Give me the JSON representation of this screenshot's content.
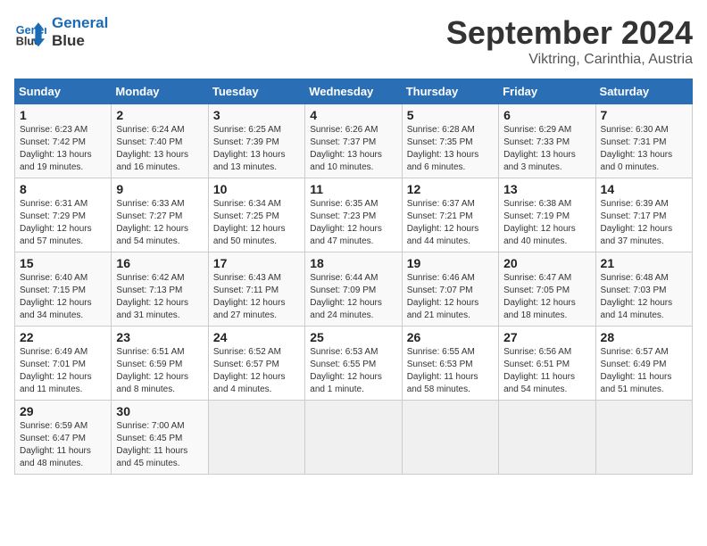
{
  "header": {
    "logo_line1": "General",
    "logo_line2": "Blue",
    "month": "September 2024",
    "location": "Viktring, Carinthia, Austria"
  },
  "weekdays": [
    "Sunday",
    "Monday",
    "Tuesday",
    "Wednesday",
    "Thursday",
    "Friday",
    "Saturday"
  ],
  "weeks": [
    [
      {
        "day": "1",
        "lines": [
          "Sunrise: 6:23 AM",
          "Sunset: 7:42 PM",
          "Daylight: 13 hours",
          "and 19 minutes."
        ]
      },
      {
        "day": "2",
        "lines": [
          "Sunrise: 6:24 AM",
          "Sunset: 7:40 PM",
          "Daylight: 13 hours",
          "and 16 minutes."
        ]
      },
      {
        "day": "3",
        "lines": [
          "Sunrise: 6:25 AM",
          "Sunset: 7:39 PM",
          "Daylight: 13 hours",
          "and 13 minutes."
        ]
      },
      {
        "day": "4",
        "lines": [
          "Sunrise: 6:26 AM",
          "Sunset: 7:37 PM",
          "Daylight: 13 hours",
          "and 10 minutes."
        ]
      },
      {
        "day": "5",
        "lines": [
          "Sunrise: 6:28 AM",
          "Sunset: 7:35 PM",
          "Daylight: 13 hours",
          "and 6 minutes."
        ]
      },
      {
        "day": "6",
        "lines": [
          "Sunrise: 6:29 AM",
          "Sunset: 7:33 PM",
          "Daylight: 13 hours",
          "and 3 minutes."
        ]
      },
      {
        "day": "7",
        "lines": [
          "Sunrise: 6:30 AM",
          "Sunset: 7:31 PM",
          "Daylight: 13 hours",
          "and 0 minutes."
        ]
      }
    ],
    [
      {
        "day": "8",
        "lines": [
          "Sunrise: 6:31 AM",
          "Sunset: 7:29 PM",
          "Daylight: 12 hours",
          "and 57 minutes."
        ]
      },
      {
        "day": "9",
        "lines": [
          "Sunrise: 6:33 AM",
          "Sunset: 7:27 PM",
          "Daylight: 12 hours",
          "and 54 minutes."
        ]
      },
      {
        "day": "10",
        "lines": [
          "Sunrise: 6:34 AM",
          "Sunset: 7:25 PM",
          "Daylight: 12 hours",
          "and 50 minutes."
        ]
      },
      {
        "day": "11",
        "lines": [
          "Sunrise: 6:35 AM",
          "Sunset: 7:23 PM",
          "Daylight: 12 hours",
          "and 47 minutes."
        ]
      },
      {
        "day": "12",
        "lines": [
          "Sunrise: 6:37 AM",
          "Sunset: 7:21 PM",
          "Daylight: 12 hours",
          "and 44 minutes."
        ]
      },
      {
        "day": "13",
        "lines": [
          "Sunrise: 6:38 AM",
          "Sunset: 7:19 PM",
          "Daylight: 12 hours",
          "and 40 minutes."
        ]
      },
      {
        "day": "14",
        "lines": [
          "Sunrise: 6:39 AM",
          "Sunset: 7:17 PM",
          "Daylight: 12 hours",
          "and 37 minutes."
        ]
      }
    ],
    [
      {
        "day": "15",
        "lines": [
          "Sunrise: 6:40 AM",
          "Sunset: 7:15 PM",
          "Daylight: 12 hours",
          "and 34 minutes."
        ]
      },
      {
        "day": "16",
        "lines": [
          "Sunrise: 6:42 AM",
          "Sunset: 7:13 PM",
          "Daylight: 12 hours",
          "and 31 minutes."
        ]
      },
      {
        "day": "17",
        "lines": [
          "Sunrise: 6:43 AM",
          "Sunset: 7:11 PM",
          "Daylight: 12 hours",
          "and 27 minutes."
        ]
      },
      {
        "day": "18",
        "lines": [
          "Sunrise: 6:44 AM",
          "Sunset: 7:09 PM",
          "Daylight: 12 hours",
          "and 24 minutes."
        ]
      },
      {
        "day": "19",
        "lines": [
          "Sunrise: 6:46 AM",
          "Sunset: 7:07 PM",
          "Daylight: 12 hours",
          "and 21 minutes."
        ]
      },
      {
        "day": "20",
        "lines": [
          "Sunrise: 6:47 AM",
          "Sunset: 7:05 PM",
          "Daylight: 12 hours",
          "and 18 minutes."
        ]
      },
      {
        "day": "21",
        "lines": [
          "Sunrise: 6:48 AM",
          "Sunset: 7:03 PM",
          "Daylight: 12 hours",
          "and 14 minutes."
        ]
      }
    ],
    [
      {
        "day": "22",
        "lines": [
          "Sunrise: 6:49 AM",
          "Sunset: 7:01 PM",
          "Daylight: 12 hours",
          "and 11 minutes."
        ]
      },
      {
        "day": "23",
        "lines": [
          "Sunrise: 6:51 AM",
          "Sunset: 6:59 PM",
          "Daylight: 12 hours",
          "and 8 minutes."
        ]
      },
      {
        "day": "24",
        "lines": [
          "Sunrise: 6:52 AM",
          "Sunset: 6:57 PM",
          "Daylight: 12 hours",
          "and 4 minutes."
        ]
      },
      {
        "day": "25",
        "lines": [
          "Sunrise: 6:53 AM",
          "Sunset: 6:55 PM",
          "Daylight: 12 hours",
          "and 1 minute."
        ]
      },
      {
        "day": "26",
        "lines": [
          "Sunrise: 6:55 AM",
          "Sunset: 6:53 PM",
          "Daylight: 11 hours",
          "and 58 minutes."
        ]
      },
      {
        "day": "27",
        "lines": [
          "Sunrise: 6:56 AM",
          "Sunset: 6:51 PM",
          "Daylight: 11 hours",
          "and 54 minutes."
        ]
      },
      {
        "day": "28",
        "lines": [
          "Sunrise: 6:57 AM",
          "Sunset: 6:49 PM",
          "Daylight: 11 hours",
          "and 51 minutes."
        ]
      }
    ],
    [
      {
        "day": "29",
        "lines": [
          "Sunrise: 6:59 AM",
          "Sunset: 6:47 PM",
          "Daylight: 11 hours",
          "and 48 minutes."
        ]
      },
      {
        "day": "30",
        "lines": [
          "Sunrise: 7:00 AM",
          "Sunset: 6:45 PM",
          "Daylight: 11 hours",
          "and 45 minutes."
        ]
      },
      {
        "day": "",
        "lines": []
      },
      {
        "day": "",
        "lines": []
      },
      {
        "day": "",
        "lines": []
      },
      {
        "day": "",
        "lines": []
      },
      {
        "day": "",
        "lines": []
      }
    ]
  ]
}
